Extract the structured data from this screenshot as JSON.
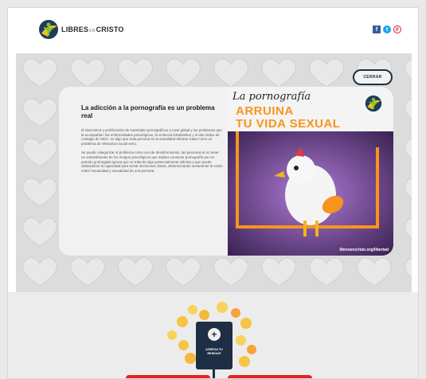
{
  "header": {
    "logo_part1": "LIBRES",
    "logo_part2": "EN",
    "logo_part3": "CRISTO",
    "social": {
      "facebook": "f",
      "twitter": "t",
      "pinterest": "p"
    }
  },
  "hero": {
    "close_label": "CERRAR",
    "title": "La adicción a la pornografía es un problema real",
    "paragraph1": "El descontrol y proliferación de materiales pornográficos a nivel global y los problemas que la acompañan: las enfermedades psicológicas, la violencia intrafamiliar y el alto índice de contagio de SIDA, es algo que toda persona en la actualidad debiese tratar como un problema de relevancia social serio.",
    "paragraph2": "Se puede categorizar el problema como uno de desinformación, las personas al no tener un entendimiento de los riesgos psicológicos que implica consumir pornografía por un periodo prolongado ignora que se trata de algo potencialmente adictivo y que puede obstaculizar la capacidad para tomar decisiones claras, distorsionando seriamente la visión sobre humanidad y sexualidad de una persona.",
    "poster": {
      "script": "La pornografía",
      "line1": "ARRUINA",
      "line2": "TU VIDA SEXUAL",
      "url": "libresencristo.org/libertad"
    }
  },
  "lower": {
    "add_message_line1": "AGREGA TU",
    "add_message_line2": "MENSAJE"
  },
  "colors": {
    "navy": "#1e2f45",
    "orange": "#f7941d",
    "red": "#e02424",
    "facebook": "#3b5998",
    "twitter": "#1da1f2",
    "pinterest": "#cb2027"
  },
  "icons": [
    "logo-icon",
    "facebook-icon",
    "twitter-icon",
    "pinterest-icon",
    "plus-icon",
    "emoji-icon"
  ]
}
